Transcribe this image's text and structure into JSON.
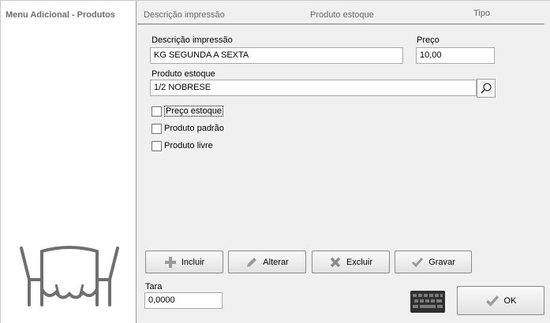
{
  "sidebar": {
    "title": "Menu Adicional - Produtos"
  },
  "header": {
    "col_description": "Descrição impressão",
    "col_product": "Produto estoque",
    "col_type": "Tipo"
  },
  "form": {
    "description_label": "Descrição impressão",
    "description_value": "KG SEGUNDA A SEXTA",
    "price_label": "Preço",
    "price_value": "10,00",
    "stock_product_label": "Produto estoque",
    "stock_product_value": "1/2 NOBRESE",
    "checkboxes": [
      {
        "label": "Preço estoque",
        "checked": false
      },
      {
        "label": "Produto padrão",
        "checked": false
      },
      {
        "label": "Produto livre",
        "checked": false
      }
    ],
    "tara_label": "Tara",
    "tara_value": "0,0000"
  },
  "buttons": {
    "include": "Incluir",
    "edit": "Alterar",
    "delete": "Excluir",
    "save": "Gravar",
    "ok": "OK"
  },
  "icons": {
    "search": "search-icon",
    "plus": "plus-icon",
    "pencil": "pencil-icon",
    "delete": "x-icon",
    "check": "check-icon",
    "keyboard": "keyboard-icon",
    "table": "table-chairs-icon"
  }
}
